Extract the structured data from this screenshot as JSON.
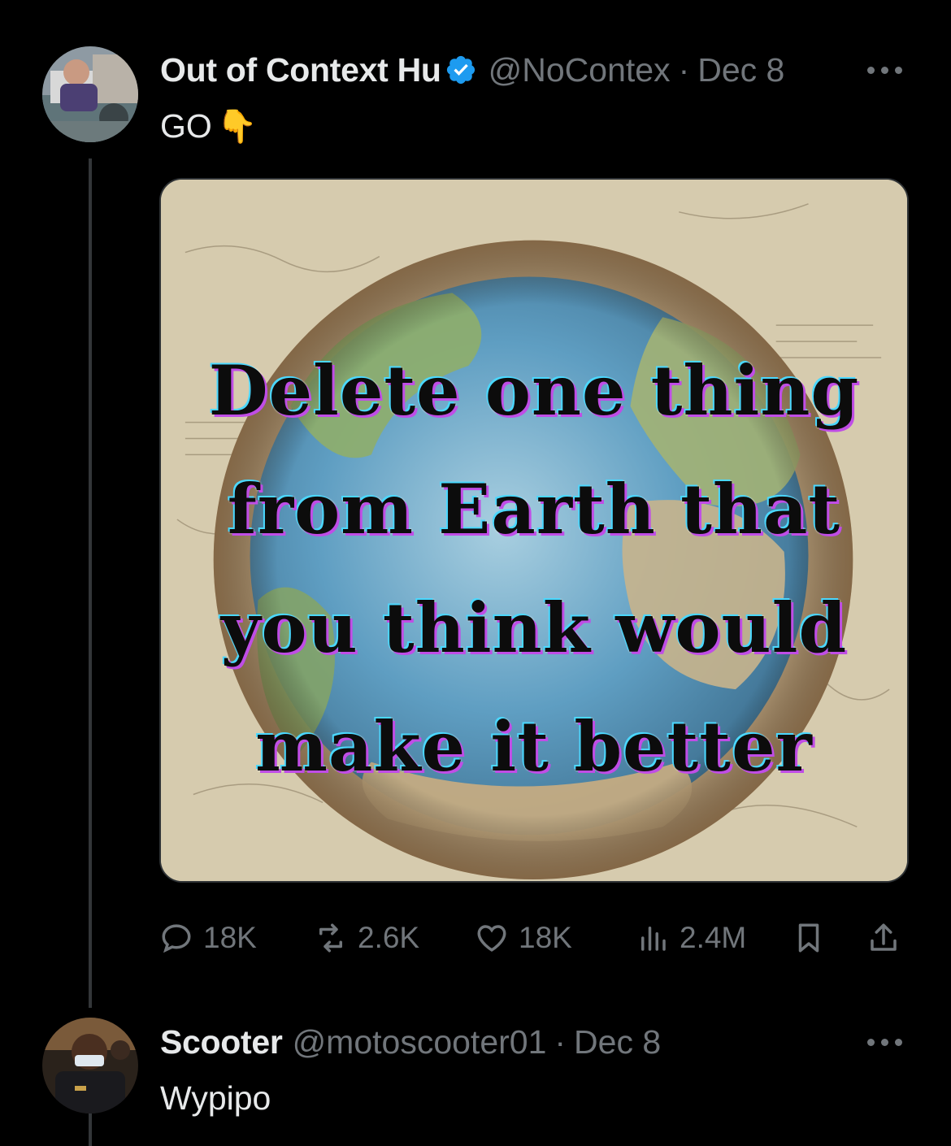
{
  "tweet": {
    "author_name": "Out of Context Hu",
    "author_handle": "@NoContex",
    "separator": "·",
    "date": "Dec 8",
    "text": "GO",
    "emoji": "👇",
    "meme_lines": [
      "Delete one thing",
      "from Earth that",
      "you think would",
      "make it better"
    ],
    "stats": {
      "replies": "18K",
      "reposts": "2.6K",
      "likes": "18K",
      "views": "2.4M"
    }
  },
  "reply": {
    "author_name": "Scooter",
    "author_handle": "@motoscooter01",
    "separator": "·",
    "date": "Dec 8",
    "text": "Wypipo"
  },
  "colors": {
    "background": "#000000",
    "text_primary": "#e7e9ea",
    "text_secondary": "#71767b",
    "verified_badge": "#1d9bf0",
    "thread_line": "#333639"
  }
}
